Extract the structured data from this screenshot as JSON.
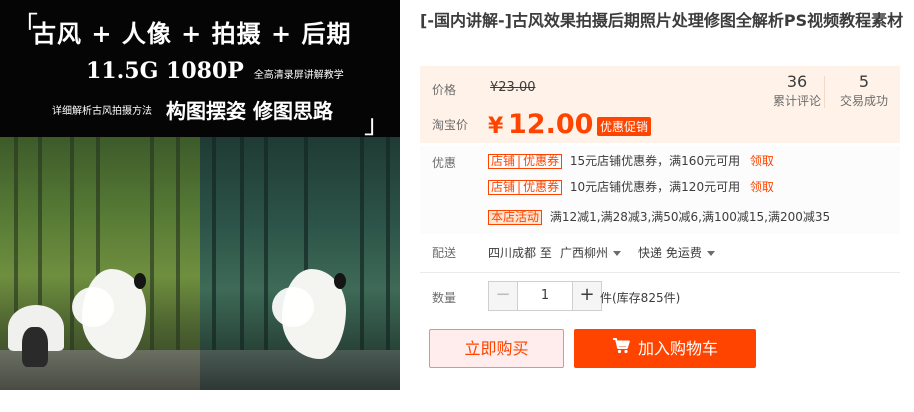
{
  "banner": {
    "headline": "古风 + 人像 + 拍摄 + 后期",
    "spec": "11.5G 1080P",
    "spec_note": "全高清录屏讲解教学",
    "tag_note": "详细解析古风拍摄方法",
    "tag_main": "构图摆姿 修图思路",
    "bracket_open": "「",
    "bracket_close": "」"
  },
  "product": {
    "title": "[-国内讲解-]古风效果拍摄后期照片处理修图全解析PS视频教程素材"
  },
  "price": {
    "label": "价格",
    "original": "¥23.00",
    "promo_label": "淘宝价",
    "currency": "¥",
    "current": "12.00",
    "promo_badge": "优惠促销"
  },
  "stats": [
    {
      "value": "36",
      "label": "累计评论"
    },
    {
      "value": "5",
      "label": "交易成功"
    }
  ],
  "discount": {
    "label": "优惠",
    "coupons": [
      {
        "tag_a": "店铺",
        "tag_b": "优惠券",
        "text": "15元店铺优惠券，满160元可用",
        "link": "领取"
      },
      {
        "tag_a": "店铺",
        "tag_b": "优惠券",
        "text": "10元店铺优惠券，满120元可用",
        "link": "领取"
      }
    ],
    "activity_tag": "本店活动",
    "activity_text": "满12减1,满28减3,满50减6,满100减15,满200减35"
  },
  "shipping": {
    "label": "配送",
    "from": "四川成都 至",
    "to": "广西柳州",
    "method": "快递 免运费"
  },
  "quantity": {
    "label": "数量",
    "minus": "−",
    "value": "1",
    "plus": "+",
    "stock": "件(库存825件)"
  },
  "actions": {
    "buy_now": "立即购买",
    "add_to_cart": "加入购物车"
  },
  "colors": {
    "accent": "#ff4400",
    "price_bg": "#fff2e8"
  }
}
